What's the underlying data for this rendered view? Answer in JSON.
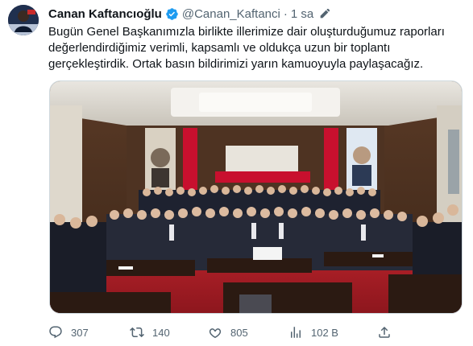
{
  "author": {
    "name": "Canan Kaftancıoğlu",
    "handle": "@Canan_Kaftanci",
    "separator": "·",
    "time": "1 sa",
    "verified_color": "#1d9bf0"
  },
  "tweet": {
    "text": "Bugün Genel Başkanımızla birlikte illerimize dair oluşturduğumuz raporları değerlendirdiğimiz verimli, kapsamlı ve oldukça uzun bir toplantı gerçekleştirdik. Ortak basın bildirimizi yarın kamuoyuyla paylaşacağız."
  },
  "actions": {
    "reply_count": "307",
    "retweet_count": "140",
    "like_count": "805",
    "views_count": "102 B"
  },
  "icons": {
    "avatar": "avatar-icon",
    "verified": "verified-badge-icon",
    "edit": "edit-icon",
    "reply": "reply-icon",
    "retweet": "retweet-icon",
    "like": "heart-icon",
    "views": "bar-chart-icon",
    "share": "share-icon"
  },
  "colors": {
    "text": "#0f1419",
    "secondary": "#536471",
    "accent": "#1d9bf0"
  }
}
